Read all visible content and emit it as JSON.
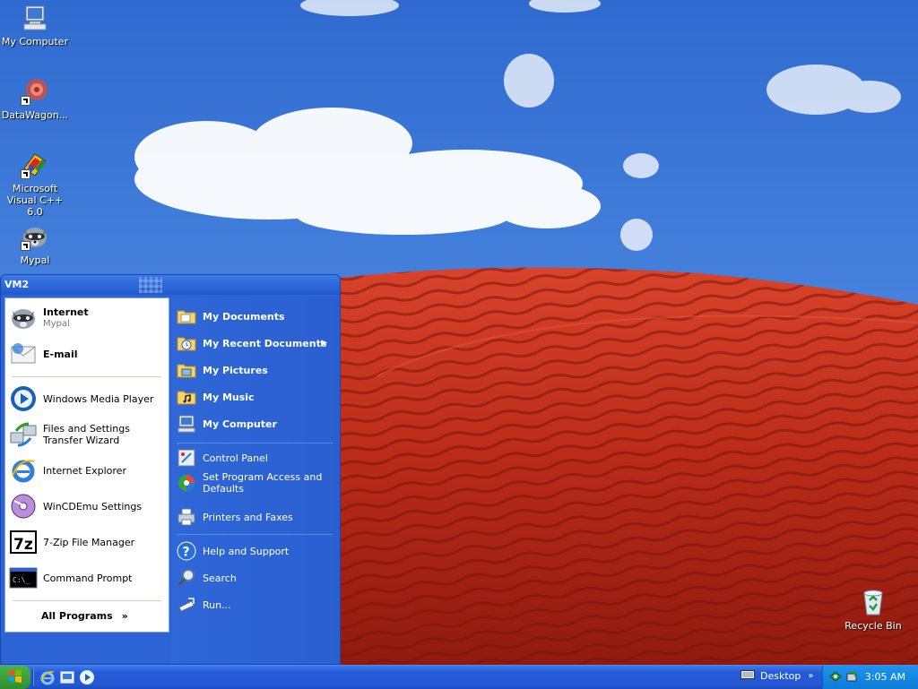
{
  "colors": {
    "sky": "#3a78d8",
    "dune": "#c8301c",
    "start_menu_blue": "#2c63d5",
    "taskbar_blue": "#245ad8",
    "tray_blue": "#148ae6",
    "start_button_green": "#3a9e3a"
  },
  "desktop": {
    "icons": [
      {
        "label": "My Computer",
        "icon": "computer-icon"
      },
      {
        "label": "DataWagon...",
        "icon": "datawagon-icon"
      },
      {
        "label": "Microsoft Visual C++ 6.0",
        "icon": "visual-cpp-icon"
      },
      {
        "label": "Mypal",
        "icon": "mypal-icon"
      },
      {
        "label": "Recycle Bin",
        "icon": "recycle-bin-icon"
      }
    ]
  },
  "start_menu": {
    "user": "VM2",
    "pinned": [
      {
        "title": "Internet",
        "subtitle": "Mypal",
        "icon": "mypal-icon"
      },
      {
        "title": "E-mail",
        "icon": "email-icon"
      }
    ],
    "recent": [
      {
        "label": "Windows Media Player",
        "icon": "media-player-icon"
      },
      {
        "label": "Files and Settings Transfer Wizard",
        "icon": "transfer-wizard-icon"
      },
      {
        "label": "Internet Explorer",
        "icon": "internet-explorer-icon"
      },
      {
        "label": "WinCDEmu Settings",
        "icon": "wincdemu-icon"
      },
      {
        "label": "7-Zip File Manager",
        "icon": "7zip-icon"
      },
      {
        "label": "Command Prompt",
        "icon": "command-prompt-icon"
      }
    ],
    "all_programs": "All Programs",
    "all_programs_arrow": "»",
    "places": [
      {
        "label": "My Documents",
        "icon": "folder-documents-icon"
      },
      {
        "label": "My Recent Documents",
        "icon": "recent-documents-icon",
        "arrow": "▶"
      },
      {
        "label": "My Pictures",
        "icon": "folder-pictures-icon"
      },
      {
        "label": "My Music",
        "icon": "folder-music-icon"
      },
      {
        "label": "My Computer",
        "icon": "computer-icon"
      }
    ],
    "system": [
      {
        "label": "Control Panel",
        "icon": "control-panel-icon"
      },
      {
        "label": "Set Program Access and Defaults",
        "icon": "program-access-icon"
      },
      {
        "label": "Printers and Faxes",
        "icon": "printer-icon"
      }
    ],
    "support": [
      {
        "label": "Help and Support",
        "icon": "help-icon"
      },
      {
        "label": "Search",
        "icon": "search-icon"
      },
      {
        "label": "Run...",
        "icon": "run-icon"
      }
    ]
  },
  "taskbar": {
    "quick_launch": [
      "internet-explorer-icon",
      "show-desktop-icon",
      "media-player-icon"
    ],
    "toolbar_label": "Desktop",
    "toolbar_chevron": "»",
    "tray_icons": [
      "network-icon",
      "safely-remove-icon"
    ],
    "clock": "3:05 AM"
  }
}
